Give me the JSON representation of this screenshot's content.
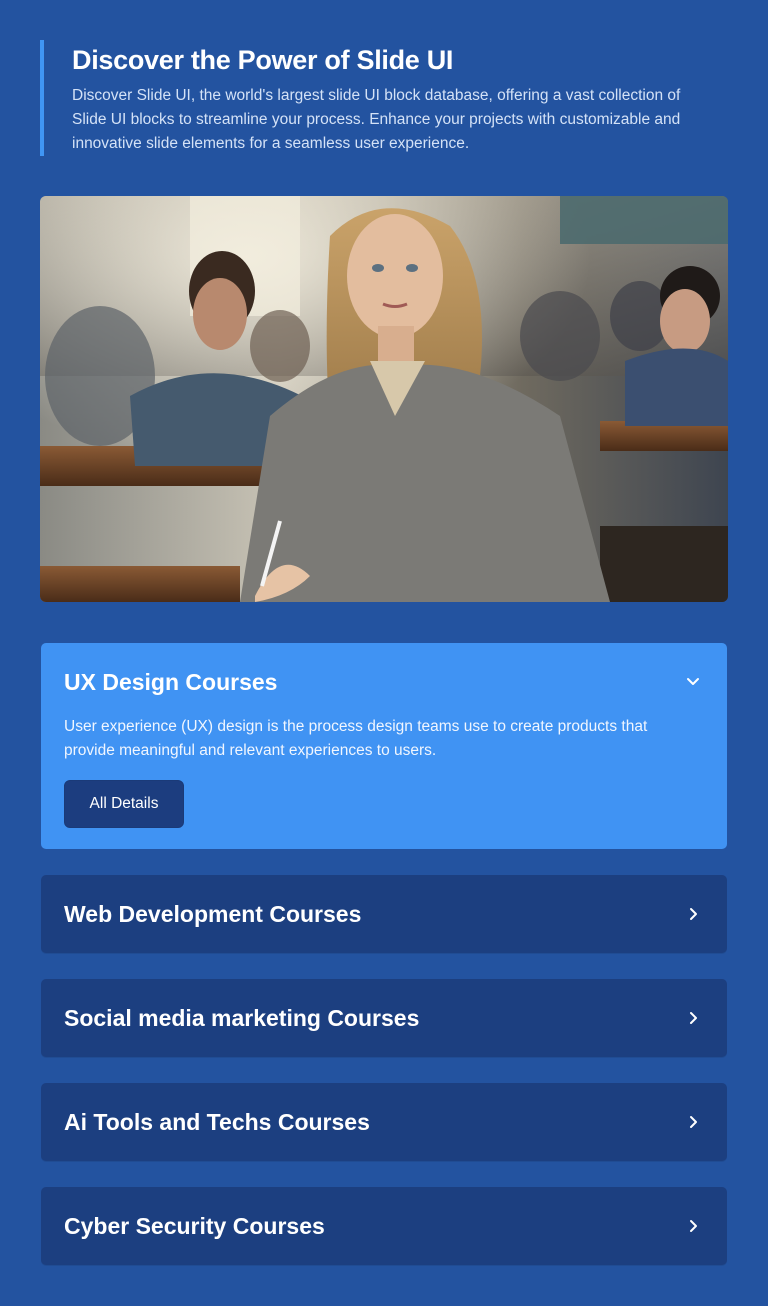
{
  "intro": {
    "title": "Discover the Power of Slide UI",
    "description": "Discover Slide UI, the world's largest slide UI block database, offering a vast collection of Slide UI blocks to streamline your process. Enhance your projects with customizable and innovative slide elements for a seamless user experience."
  },
  "accordion": {
    "open_item": {
      "title": "UX Design Courses",
      "description": "User experience (UX) design is the process design teams use to create products that provide meaningful and relevant experiences to users.",
      "button_label": "All Details",
      "icon": "chevron-down-icon"
    },
    "items": [
      {
        "title": "Web Development Courses",
        "icon": "chevron-right-icon"
      },
      {
        "title": "Social media marketing Courses",
        "icon": "chevron-right-icon"
      },
      {
        "title": "Ai Tools and Techs Courses",
        "icon": "chevron-right-icon"
      },
      {
        "title": "Cyber Security Courses",
        "icon": "chevron-right-icon"
      }
    ]
  },
  "colors": {
    "background": "#2353a0",
    "accent_bar": "#4096f4",
    "open_panel": "#4093f3",
    "closed_panel": "#1c3f80",
    "button": "#1c3d7f"
  }
}
